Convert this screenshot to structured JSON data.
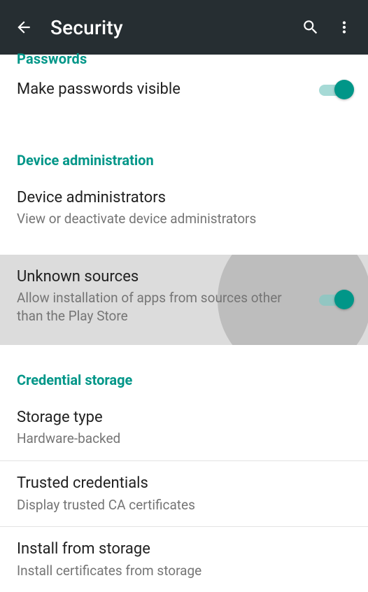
{
  "appbar": {
    "title": "Security"
  },
  "sections": {
    "passwords": {
      "header": "Passwords",
      "make_visible": {
        "title": "Make passwords visible",
        "on": true
      }
    },
    "device_admin": {
      "header": "Device administration",
      "device_admins": {
        "title": "Device administrators",
        "sub": "View or deactivate device administrators"
      },
      "unknown_sources": {
        "title": "Unknown sources",
        "sub": "Allow installation of apps from sources other than the Play Store",
        "on": true
      }
    },
    "credential_storage": {
      "header": "Credential storage",
      "storage_type": {
        "title": "Storage type",
        "sub": "Hardware-backed"
      },
      "trusted_credentials": {
        "title": "Trusted credentials",
        "sub": "Display trusted CA certificates"
      },
      "install_from_storage": {
        "title": "Install from storage",
        "sub": "Install certificates from storage"
      }
    }
  },
  "colors": {
    "accent": "#009688",
    "appbar_bg": "#262e32"
  }
}
